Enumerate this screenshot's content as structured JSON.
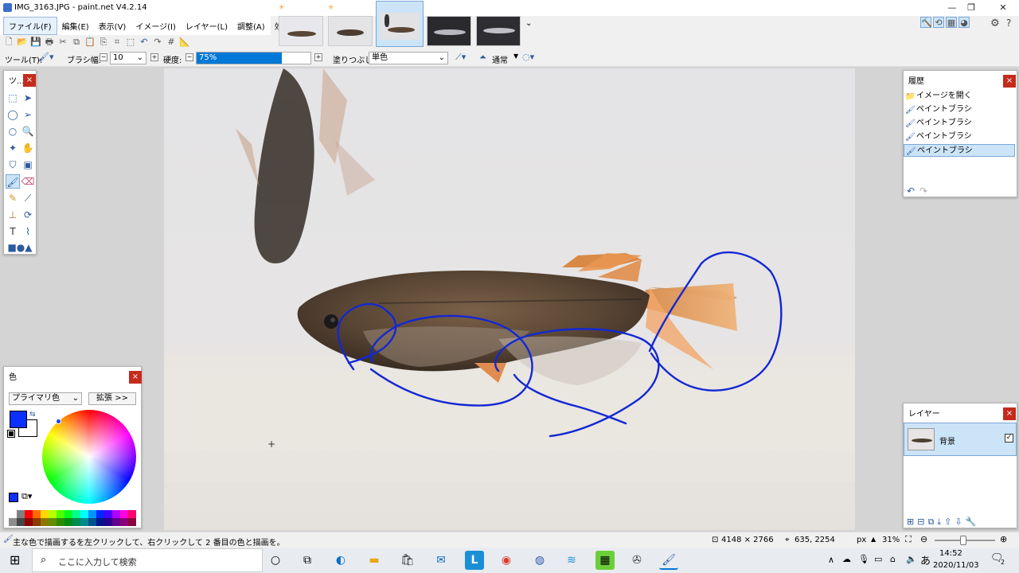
{
  "window": {
    "title": "IMG_3163.JPG - paint.net V4.2.14",
    "minimize": "—",
    "restore": "❐",
    "close": "✕"
  },
  "menu": [
    "ファイル(F)",
    "編集(E)",
    "表示(V)",
    "イメージ(I)",
    "レイヤー(L)",
    "調整(A)",
    "効果(C)"
  ],
  "image_strip": {
    "dirty_marker": "✳",
    "more": "⌄"
  },
  "toolbar": {
    "tool_label": "ツール(T):",
    "brush_width_label": "ブラシ幅:",
    "brush_width_value": "10",
    "hardness_label": "硬度:",
    "hardness_value": "75%",
    "hardness_fraction": 0.75,
    "fill_label": "塗りつぶし:",
    "fill_value": "単色",
    "blend_mode": "通常"
  },
  "tools_panel": {
    "title": "ツ...",
    "close": "×"
  },
  "history_panel": {
    "title": "履歴",
    "close": "×",
    "items": [
      "イメージを開く",
      "ペイントブラシ",
      "ペイントブラシ",
      "ペイントブラシ",
      "ペイントブラシ"
    ],
    "selected_index": 4
  },
  "layers_panel": {
    "title": "レイヤー",
    "close": "×",
    "layers": [
      {
        "name": "背景",
        "visible": true
      }
    ]
  },
  "colors_panel": {
    "title": "色",
    "close": "×",
    "mode": "プライマリ色",
    "expand_button": "拡張 >>",
    "primary_color": "#0a2fff",
    "secondary_color": "#ffffff"
  },
  "palette": [
    "#ffffff",
    "#808080",
    "#ff0000",
    "#ff6a00",
    "#ffd800",
    "#b6ff00",
    "#4cff00",
    "#00ff21",
    "#00ff90",
    "#00ffff",
    "#0094ff",
    "#0026ff",
    "#4800ff",
    "#b200ff",
    "#ff00dc",
    "#ff006e"
  ],
  "status": {
    "hint": "主な色で描画するを左クリックして、右クリックして 2 番目の色と描画を。",
    "image_size": "4148 × 2766",
    "cursor_pos": "635, 2254",
    "units": "px",
    "zoom": "31%"
  },
  "taskbar": {
    "search_placeholder": "ここに入力して検索",
    "time": "14:52",
    "date": "2020/11/03",
    "ime": "あ",
    "notification_count": "2"
  },
  "colors": {
    "stroke": "#1228d4",
    "accent": "#0078d7",
    "close_red": "#c42b1c",
    "selection": "#cce4f7"
  }
}
